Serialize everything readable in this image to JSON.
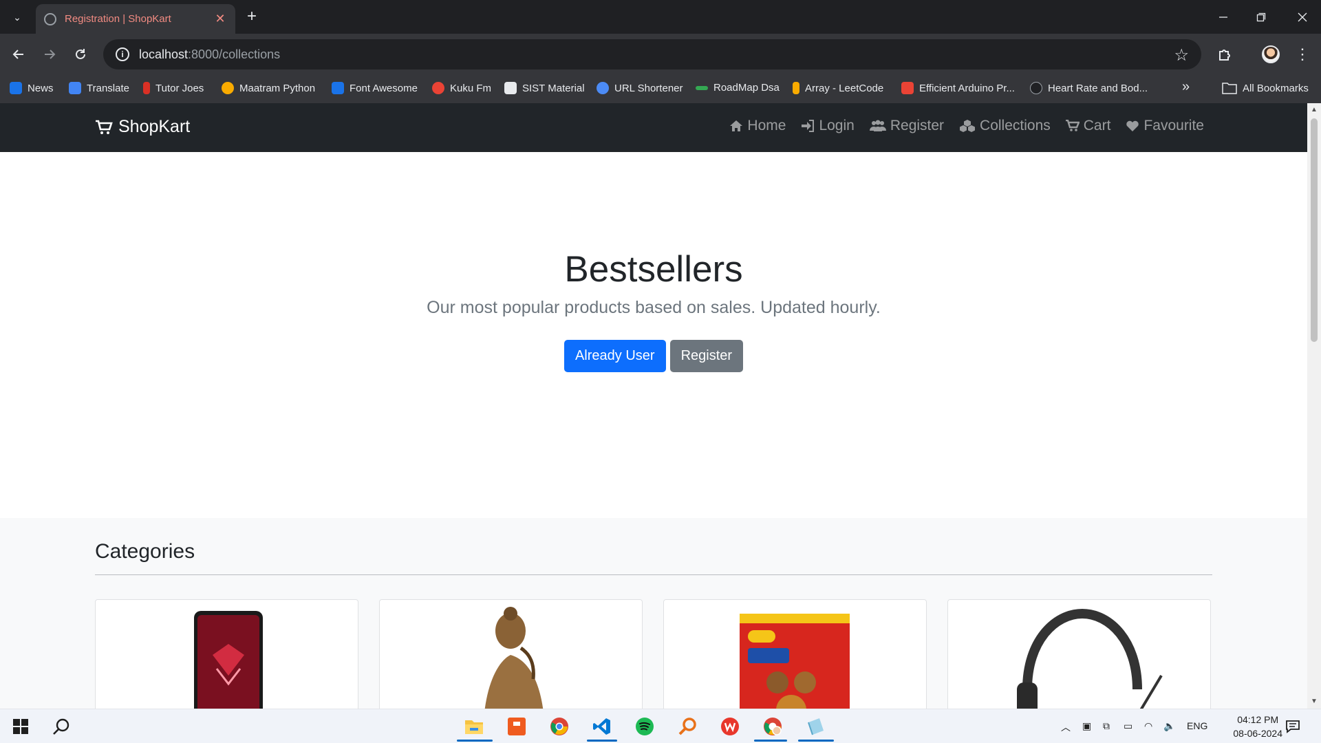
{
  "browser": {
    "tab_title": "Registration | ShopKart",
    "tab_close": "✕",
    "new_tab": "+",
    "url_host": "localhost",
    "url_path": ":8000/collections",
    "bookmarks": [
      {
        "label": "News",
        "color": "#1a73e8"
      },
      {
        "label": "Translate",
        "color": "#4285f4"
      },
      {
        "label": "Tutor Joes",
        "color": "#d93025"
      },
      {
        "label": "Maatram Python",
        "color": "#f9ab00"
      },
      {
        "label": "Font Awesome",
        "color": "#1a73e8"
      },
      {
        "label": "Kuku Fm",
        "color": "#ea4335"
      },
      {
        "label": "SIST Material",
        "color": "#e8eaed"
      },
      {
        "label": "URL Shortener",
        "color": "#4c8bf5"
      },
      {
        "label": "RoadMap Dsa",
        "color": "#34a853"
      },
      {
        "label": "Array - LeetCode",
        "color": "#f9ab00"
      },
      {
        "label": "Efficient Arduino Pr...",
        "color": "#ea4335"
      },
      {
        "label": "Heart Rate and Bod...",
        "color": "#202124"
      }
    ],
    "more_bookmarks": "»",
    "all_bookmarks": "All Bookmarks"
  },
  "site": {
    "brand": "ShopKart",
    "nav": [
      {
        "label": "Home",
        "icon": "home-icon"
      },
      {
        "label": "Login",
        "icon": "sign-in-icon"
      },
      {
        "label": "Register",
        "icon": "users-icon"
      },
      {
        "label": "Collections",
        "icon": "cubes-icon"
      },
      {
        "label": "Cart",
        "icon": "cart-icon"
      },
      {
        "label": "Favourite",
        "icon": "heart-icon"
      }
    ],
    "hero": {
      "title": "Bestsellers",
      "subtitle": "Our most popular products based on sales. Updated hourly.",
      "primary_button": "Already User",
      "secondary_button": "Register"
    },
    "categories": {
      "title": "Categories",
      "cards": [
        {
          "image": "phone-image"
        },
        {
          "image": "buddha-statue-image"
        },
        {
          "image": "noodles-pack-image"
        },
        {
          "image": "headset-image"
        }
      ]
    }
  },
  "taskbar": {
    "language": "ENG",
    "time": "04:12 PM",
    "date": "08-06-2024"
  },
  "colors": {
    "primary": "#0d6efd",
    "secondary": "#6c757d",
    "navbar": "#212529",
    "tab_title": "#f28b82"
  }
}
